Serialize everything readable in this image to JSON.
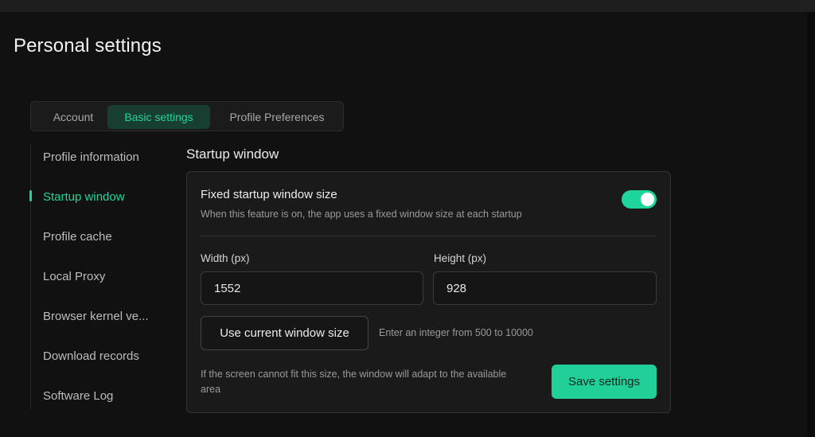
{
  "page": {
    "title": "Personal settings"
  },
  "tabs": [
    {
      "label": "Account",
      "active": false
    },
    {
      "label": "Basic settings",
      "active": true
    },
    {
      "label": "Profile Preferences",
      "active": false
    }
  ],
  "sidebar": {
    "items": [
      {
        "label": "Profile information",
        "active": false
      },
      {
        "label": "Startup window",
        "active": true
      },
      {
        "label": "Profile cache",
        "active": false
      },
      {
        "label": "Local Proxy",
        "active": false
      },
      {
        "label": "Browser kernel ve...",
        "active": false
      },
      {
        "label": "Download records",
        "active": false
      },
      {
        "label": "Software Log",
        "active": false
      }
    ]
  },
  "section": {
    "title": "Startup window",
    "feature_title": "Fixed startup window size",
    "feature_desc": "When this feature is on, the app uses a fixed window size at each startup",
    "toggle_on": true,
    "width_label": "Width (px)",
    "width_value": "1552",
    "height_label": "Height (px)",
    "height_value": "928",
    "use_current_label": "Use current window size",
    "hint": "Enter an integer from 500 to 10000",
    "note": "If the screen cannot fit this size, the window will adapt to the available area",
    "save_label": "Save settings"
  },
  "colors": {
    "accent": "#1ed69d",
    "active_tab_bg": "#183d31",
    "background": "#111111",
    "card_bg": "#1a1a1a"
  }
}
